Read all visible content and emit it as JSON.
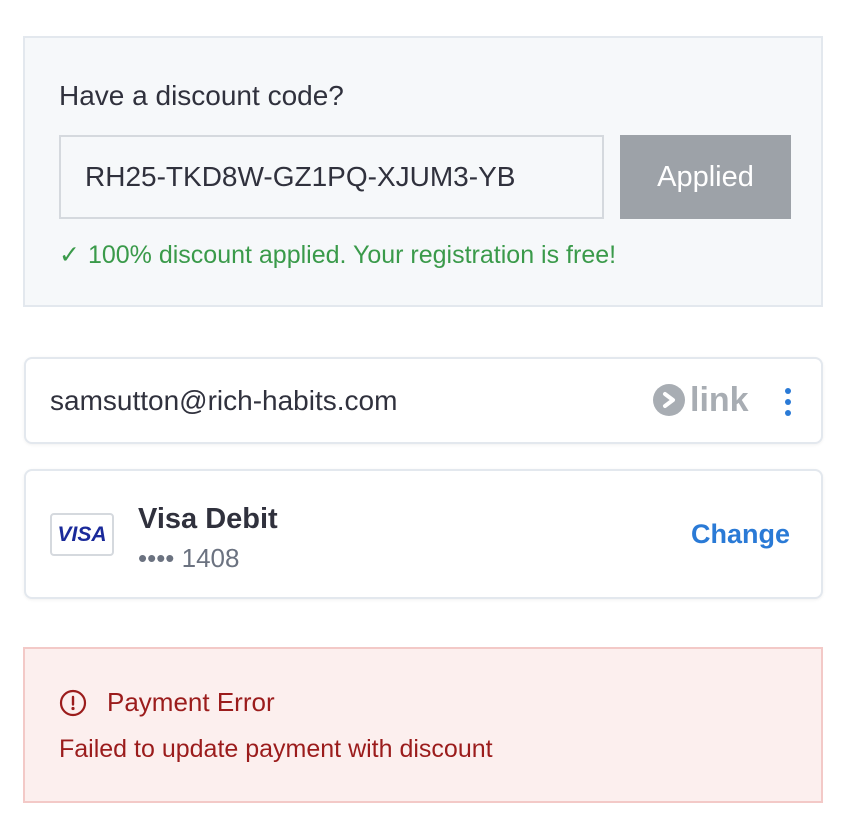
{
  "discount": {
    "title": "Have a discount code?",
    "code_value": "RH25-TKD8W-GZ1PQ-XJUM3-YB",
    "button_label": "Applied",
    "success_check": "✓",
    "success_message": "100% discount applied. Your registration is free!"
  },
  "link_account": {
    "email": "samsutton@rich-habits.com",
    "brand_word": "link",
    "menu_icon": "kebab-menu-icon"
  },
  "payment_method": {
    "brand_badge": "VISA",
    "card_name": "Visa Debit",
    "card_number": "•••• 1408",
    "change_label": "Change"
  },
  "error": {
    "icon": "alert-circle-icon",
    "title": "Payment Error",
    "message": "Failed to update payment with discount"
  },
  "colors": {
    "success": "#3a9a4a",
    "error_text": "#9b1c1c",
    "error_bg": "#fcefee",
    "link_accent": "#2a7ad6",
    "button_disabled": "#9da2a8"
  }
}
